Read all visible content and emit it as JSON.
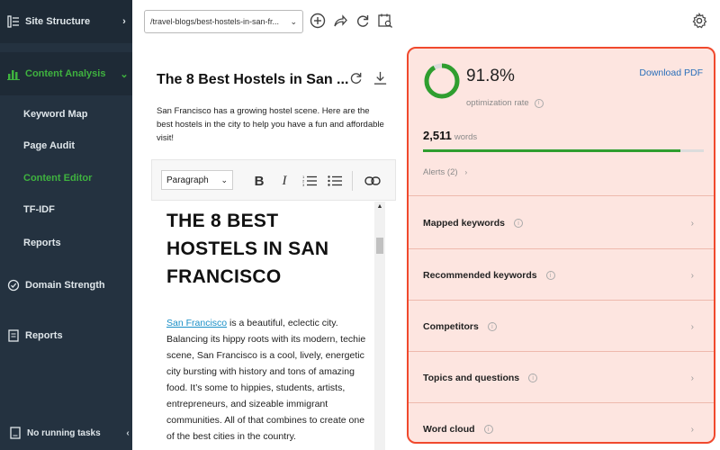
{
  "sidebar": {
    "site_structure": "Site Structure",
    "content_analysis": "Content Analysis",
    "sub_items": [
      "Keyword Map",
      "Page Audit",
      "Content Editor",
      "TF-IDF",
      "Reports"
    ],
    "domain_strength": "Domain Strength",
    "reports": "Reports",
    "no_running_tasks": "No running tasks"
  },
  "topbar": {
    "url_value": "/travel-blogs/best-hostels-in-san-fr..."
  },
  "editor": {
    "title": "The 8 Best Hostels in San ...",
    "description": "San Francisco has a growing hostel scene. Here are the best hostels in the city to help you have a fun and affordable visit!",
    "paragraph_select": "Paragraph",
    "doc_heading": "THE 8 BEST HOSTELS IN SAN FRANCISCO",
    "doc_link": "San Francisco",
    "doc_body": " is a beautiful, eclectic city. Balancing its hippy roots with its modern, techie scene, San Francisco is a cool, lively, energetic city bursting with history and tons of amazing food. It’s some to hippies, students, artists, entrepreneurs, and sizeable immigrant communities. All of that combines to create one of the best cities in the country."
  },
  "panel": {
    "score": "91.8%",
    "score_fraction": 0.918,
    "score_label": "optimization rate",
    "download_pdf": "Download PDF",
    "words_count": "2,511",
    "words_label": "words",
    "alerts": "Alerts (2)",
    "rows": [
      "Mapped keywords",
      "Recommended keywords",
      "Competitors",
      "Topics and questions",
      "Word cloud"
    ]
  },
  "colors": {
    "sidebar_bg": "#243240",
    "accent_green": "#3fb23f",
    "panel_border": "#f0492d",
    "panel_bg": "#fde5e0",
    "link_blue": "#1a8fc7"
  }
}
